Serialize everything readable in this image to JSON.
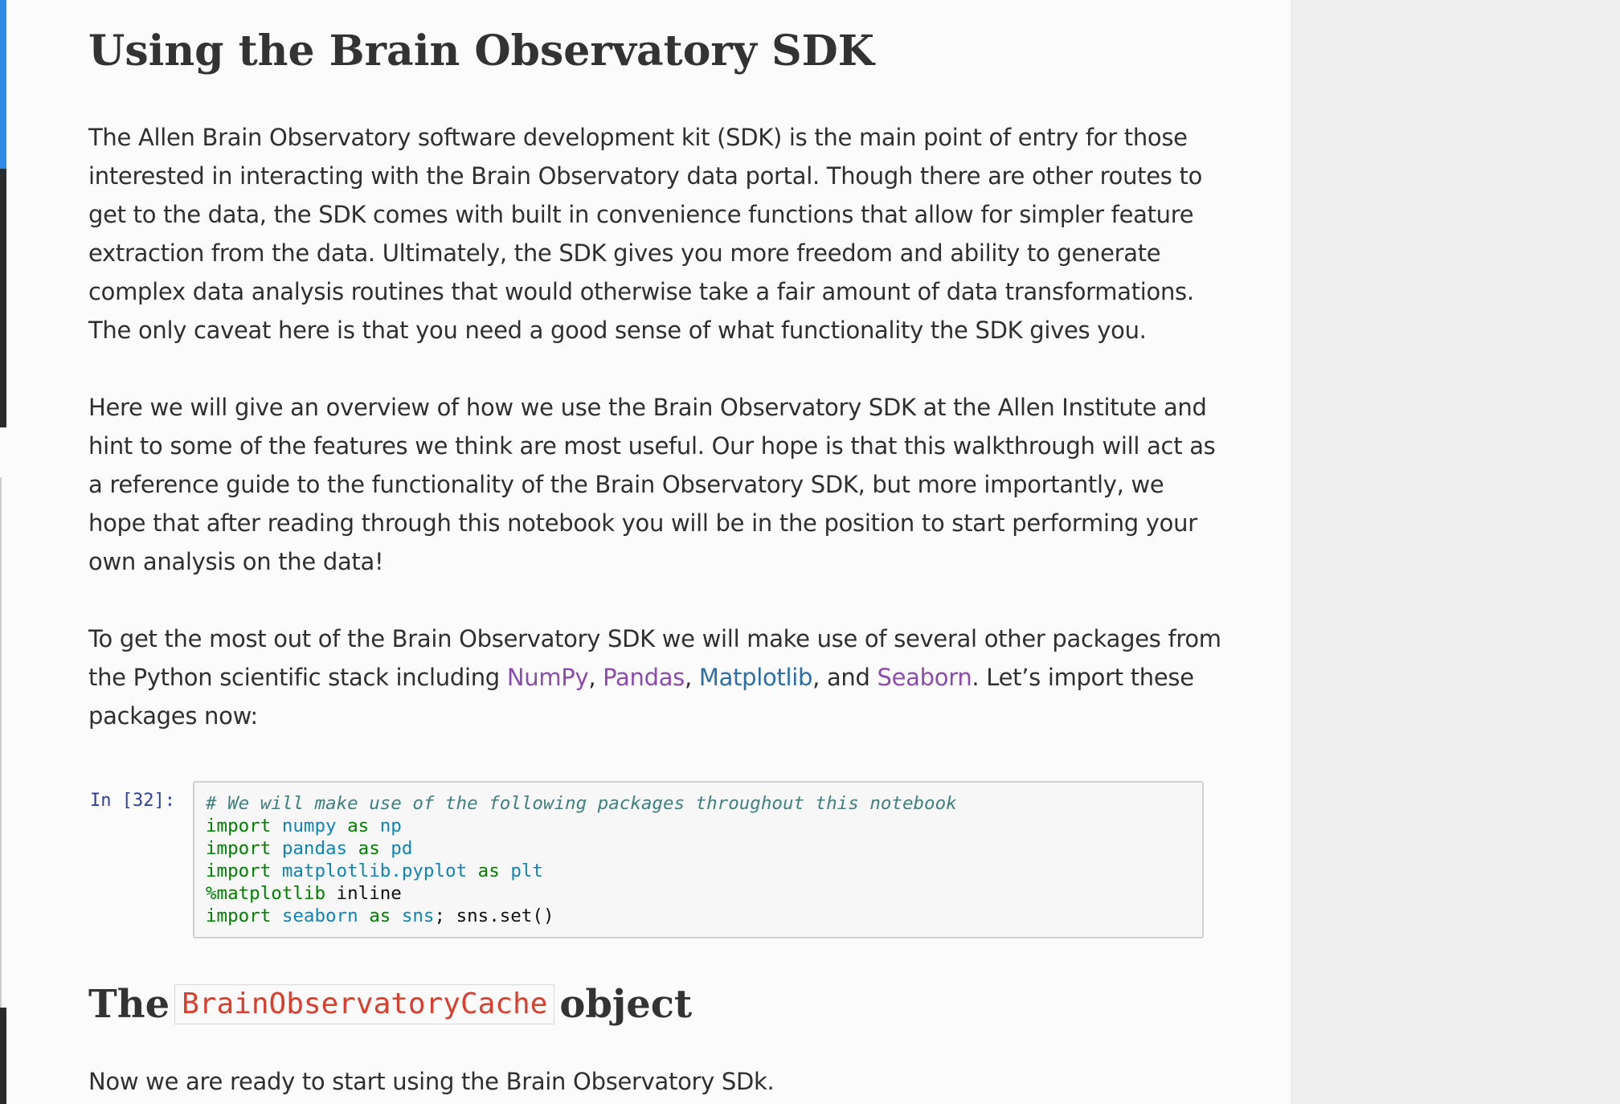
{
  "heading": "Using the Brain Observatory SDK",
  "paragraph1": {
    "lines": [
      "The Allen Brain Observatory software development kit (SDK) is the main point of entry for those",
      "interested in interacting with the Brain Observatory data portal. Though there are other routes to",
      "get to the data, the SDK comes with built in convenience functions that allow for simpler feature",
      "extraction from the data. Ultimately, the SDK gives you more freedom and ability to generate",
      "complex data analysis routines that would otherwise take a fair amount of data transformations.",
      "The only caveat here is that you need a good sense of what functionality the SDK gives you."
    ]
  },
  "paragraph2": {
    "lines": [
      "Here we will give an overview of how we use the Brain Observatory SDK at the Allen Institute and",
      "hint to some of the features we think are most useful. Our hope is that this walkthrough will act as",
      "a reference guide to the functionality of the Brain Observatory SDK, but more importantly, we",
      "hope that after reading through this notebook you will be in the position to start performing your",
      "own analysis on the data!"
    ]
  },
  "paragraph3": {
    "line1": "To get the most out of the Brain Observatory SDK we will make use of several other packages from",
    "line2_prefix": "the Python scientific stack including ",
    "link_numpy": "NumPy",
    "sep1": ", ",
    "link_pandas": "Pandas",
    "sep2": ", ",
    "link_matplotlib": "Matplotlib",
    "sep3": ", and ",
    "link_seaborn": "Seaborn",
    "line2_suffix": ". Let’s import these",
    "line3": "packages now:"
  },
  "code_cell": {
    "prompt": "In [32]:",
    "comment": "# We will make use of the following packages throughout this notebook",
    "kw_import": "import",
    "kw_as": "as",
    "numpy_mod": "numpy",
    "numpy_alias": "np",
    "pandas_mod": "pandas",
    "pandas_alias": "pd",
    "plt_mod": "matplotlib.pyplot",
    "plt_alias": "plt",
    "magic": "%matplotlib",
    "magic_arg": " inline",
    "seaborn_mod": "seaborn",
    "seaborn_alias": "sns",
    "seaborn_tail": "; sns.set()"
  },
  "section": {
    "prefix": "The",
    "code": "BrainObservatoryCache",
    "suffix": "object"
  },
  "paragraph4": "Now we are ready to start using the Brain Observatory SDk.",
  "colors": {
    "link_purple": "#8b4cae",
    "link_blue": "#2e6ea7",
    "selected_cell_bar": "#2f8be6",
    "inline_code_red": "#d7402f"
  }
}
